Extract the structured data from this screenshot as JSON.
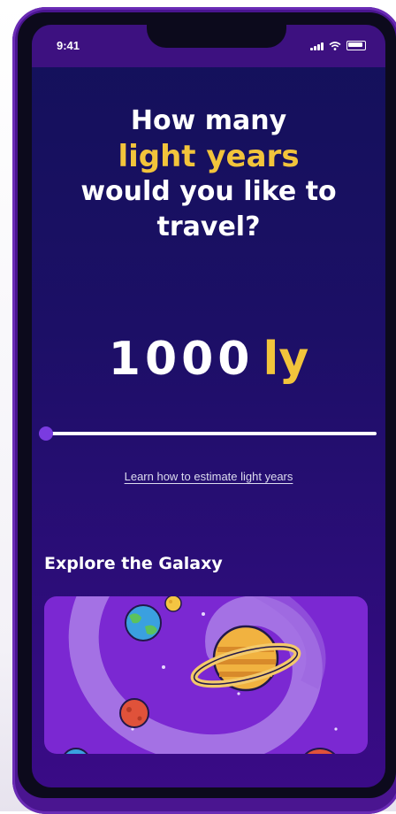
{
  "status_bar": {
    "time": "9:41"
  },
  "prompt": {
    "line1": "How many",
    "line2": "light years",
    "line3": "would you like to",
    "line4": "travel?"
  },
  "distance": {
    "value": "1000",
    "unit": "ly"
  },
  "slider": {
    "level_fraction": 0.02
  },
  "learn_link": "Learn how to estimate light years",
  "explore": {
    "title": "Explore the Galaxy"
  },
  "colors": {
    "accent_yellow": "#f2c43b",
    "slider_purple": "#7a3be0",
    "card_purple": "#7b28d2"
  },
  "icons": [
    "signal-icon",
    "wifi-icon",
    "battery-icon"
  ]
}
